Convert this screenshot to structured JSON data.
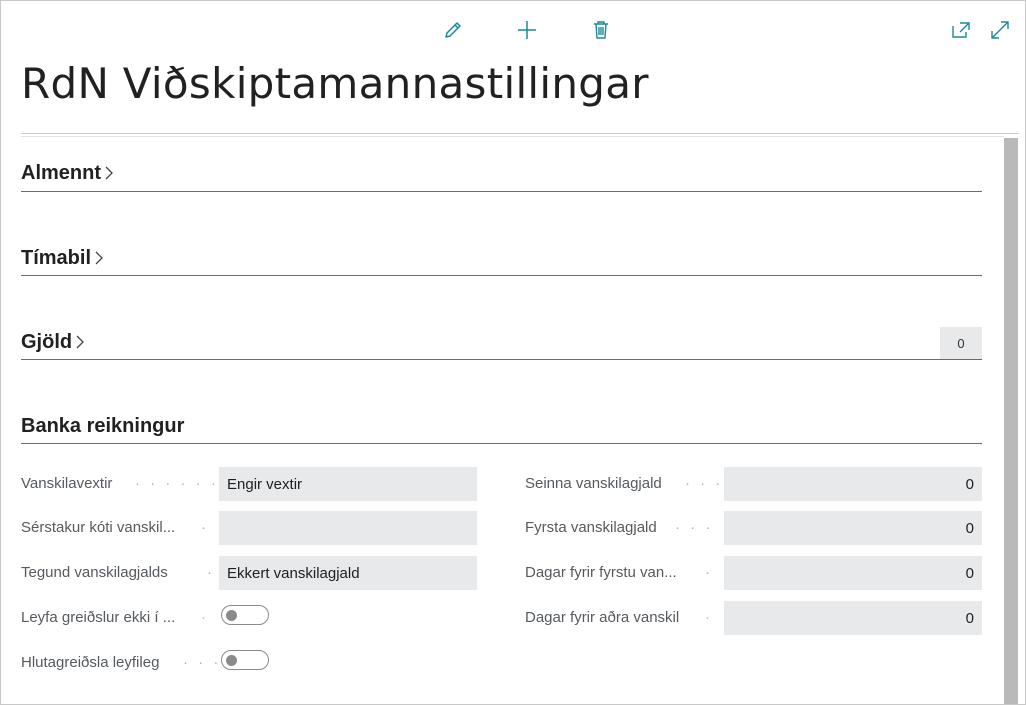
{
  "page": {
    "title": "RdN Viðskiptamannastillingar"
  },
  "toolbar": {
    "edit_icon": "pencil-icon",
    "new_icon": "plus-icon",
    "delete_icon": "trash-icon",
    "open_new_window_icon": "open-in-new-window-icon",
    "expand_icon": "expand-icon",
    "accent_color": "#1a8a9a"
  },
  "sections": {
    "almennt": {
      "title": "Almennt"
    },
    "timabil": {
      "title": "Tímabil"
    },
    "gjold": {
      "title": "Gjöld",
      "count": "0"
    },
    "banka": {
      "title": "Banka reikningur"
    }
  },
  "fields": {
    "vanskilavextir": {
      "label": "Vanskilavextir",
      "value": "Engir vextir"
    },
    "serstakur_koti": {
      "label": "Sérstakur kóti vanskil...",
      "value": ""
    },
    "tegund_vanskilagjalds": {
      "label": "Tegund vanskilagjalds",
      "value": "Ekkert vanskilagjald"
    },
    "leyfa_greidslur": {
      "label": "Leyfa greiðslur ekki í ...",
      "value": false
    },
    "hlutagreidsla": {
      "label": "Hlutagreiðsla leyfileg",
      "value": false
    },
    "seinna_vanskilagjald": {
      "label": "Seinna vanskilagjald",
      "value": "0"
    },
    "fyrsta_vanskilagjald": {
      "label": "Fyrsta vanskilagjald",
      "value": "0"
    },
    "dagar_fyrir_fyrstu": {
      "label": "Dagar fyrir fyrstu van...",
      "value": "0"
    },
    "dagar_fyrir_adra": {
      "label": "Dagar fyrir aðra vanskil",
      "value": "0"
    }
  }
}
